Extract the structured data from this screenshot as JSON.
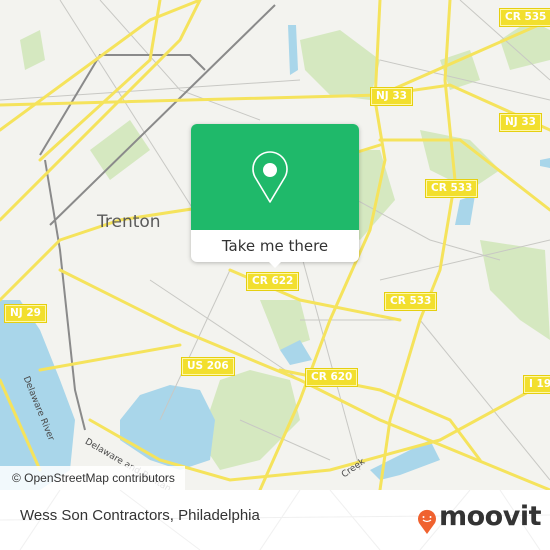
{
  "map": {
    "city_label": "Trenton",
    "river_labels": [
      "Delaware River",
      "Delaware and Raritan"
    ],
    "creek_label": "Creek",
    "road_shields": [
      {
        "id": "cr535",
        "label": "CR 535"
      },
      {
        "id": "nj33a",
        "label": "NJ 33"
      },
      {
        "id": "nj33b",
        "label": "NJ 33"
      },
      {
        "id": "cr533a",
        "label": "CR 533"
      },
      {
        "id": "cr622",
        "label": "CR 622"
      },
      {
        "id": "cr533b",
        "label": "CR 533"
      },
      {
        "id": "nj29",
        "label": "NJ 29"
      },
      {
        "id": "us206",
        "label": "US 206"
      },
      {
        "id": "cr620",
        "label": "CR 620"
      },
      {
        "id": "i195",
        "label": "I 19"
      }
    ],
    "attribution": "© OpenStreetMap contributors"
  },
  "popup": {
    "icon": "map-pin-icon",
    "action_label": "Take me there",
    "accent_color": "#1fb96a"
  },
  "footer": {
    "place_title": "Wess Son Contractors, Philadelphia",
    "brand": "moovit",
    "brand_color": "#f0622f"
  }
}
